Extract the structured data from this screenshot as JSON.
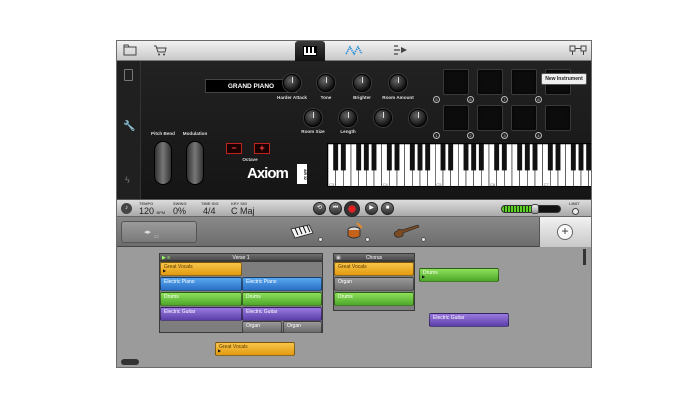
{
  "topbar": {
    "icons": [
      "folder-icon",
      "cart-icon",
      "keyboard-icon",
      "waveform-icon",
      "step-sequencer-icon",
      "mixer-icon"
    ]
  },
  "instrument": {
    "preset_name": "GRAND PIANO",
    "knobs_row1": [
      "Harder Attack",
      "Tone",
      "Brighter",
      "Room Amount"
    ],
    "knobs_row2": [
      "Room Size",
      "Length",
      "",
      ""
    ],
    "pad_numbers": [
      "5",
      "6",
      "7",
      "8",
      "1",
      "2",
      "3",
      "4"
    ],
    "pitch_bend_label": "Pitch Bend",
    "modulation_label": "Modulation",
    "octave_label": "Octave",
    "octave_down": "−",
    "octave_up": "+",
    "logo": "Axiom",
    "logo_sub": "AIR 32",
    "key_labels": [
      "C3",
      "C4",
      "C5",
      "C6",
      "C7"
    ]
  },
  "controlbar": {
    "tempo_label": "TEMPO",
    "tempo_value": "120",
    "tempo_unit": "BPM",
    "swing_label": "SWING",
    "swing_value": "0%",
    "timesig_label": "TIME SIG",
    "timesig_value": "4/4",
    "key_label": "KEY SIG",
    "key_value": "C Maj",
    "limit_label": "LIMIT",
    "volume_level": 0.55
  },
  "track_headers": {
    "new_instrument_label": "New Instrument",
    "instruments": [
      "keyboard-instrument-icon",
      "drum-instrument-icon",
      "guitar-instrument-icon"
    ]
  },
  "arrangement": {
    "sections": [
      {
        "name": "Verse 1"
      },
      {
        "name": "Chorus"
      }
    ],
    "clips": {
      "verse_great_vocals": "Great Vocals",
      "verse_electric_piano_1": "Electric Piano",
      "verse_electric_piano_2": "Electric Piano",
      "verse_drums_1": "Drums",
      "verse_drums_2": "Drums",
      "verse_electric_guitar_1": "Electric Guitar",
      "verse_electric_guitar_2": "Electric Guitar",
      "verse_organ_1": "Organ",
      "verse_organ_2": "Organ",
      "chorus_great_vocals": "Great Vocals",
      "chorus_organ": "Organ",
      "chorus_drums": "Drums",
      "free_drums": "Drums",
      "free_electric_guitar": "Electric Guitar",
      "free_great_vocals": "Great Vocals"
    }
  },
  "colors": {
    "vocals": "#e9a822",
    "piano": "#3a86dc",
    "drums": "#62c03a",
    "guitar": "#6e4fc0",
    "organ": "#7a7a7a",
    "record": "#e02020"
  }
}
